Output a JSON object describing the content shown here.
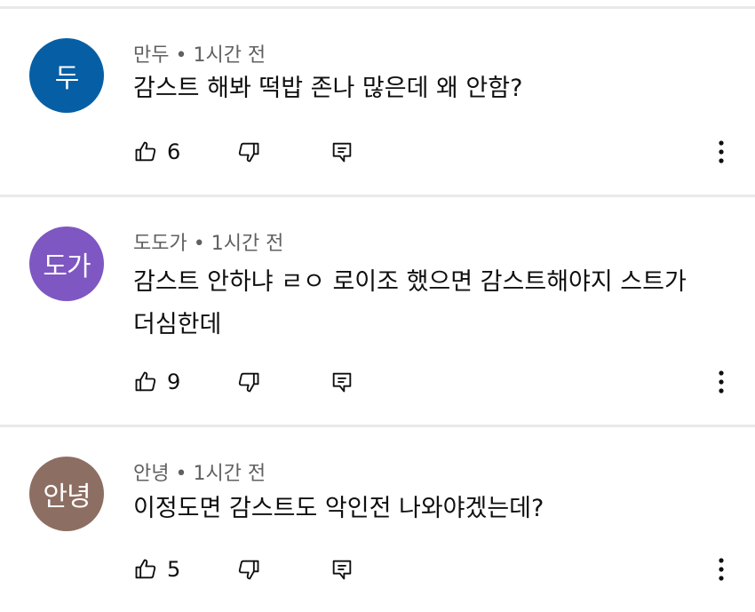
{
  "comments": [
    {
      "avatar_letter": "두",
      "avatar_color": "#065fa5",
      "author": "만두",
      "time": "1시간 전",
      "text": "감스트 해봐 떡밥 존나 많은데 왜 안함?",
      "likes": "6"
    },
    {
      "avatar_letter": "도가",
      "avatar_color": "#7e57c2",
      "author": "도도가",
      "time": "1시간 전",
      "text": "감스트 안하냐 ㄹㅇ 로이조 했으면 감스트해야지 스트가 더심한데",
      "likes": "9"
    },
    {
      "avatar_letter": "안녕",
      "avatar_color": "#8d6e63",
      "author": "안녕",
      "time": "1시간 전",
      "text": "이정도면 감스트도 악인전 나와야겠는데?",
      "likes": "5"
    }
  ],
  "separator": " • ",
  "icons": {
    "like": "thumbs-up-icon",
    "dislike": "thumbs-down-icon",
    "reply": "reply-icon",
    "more": "more-vertical-icon"
  }
}
